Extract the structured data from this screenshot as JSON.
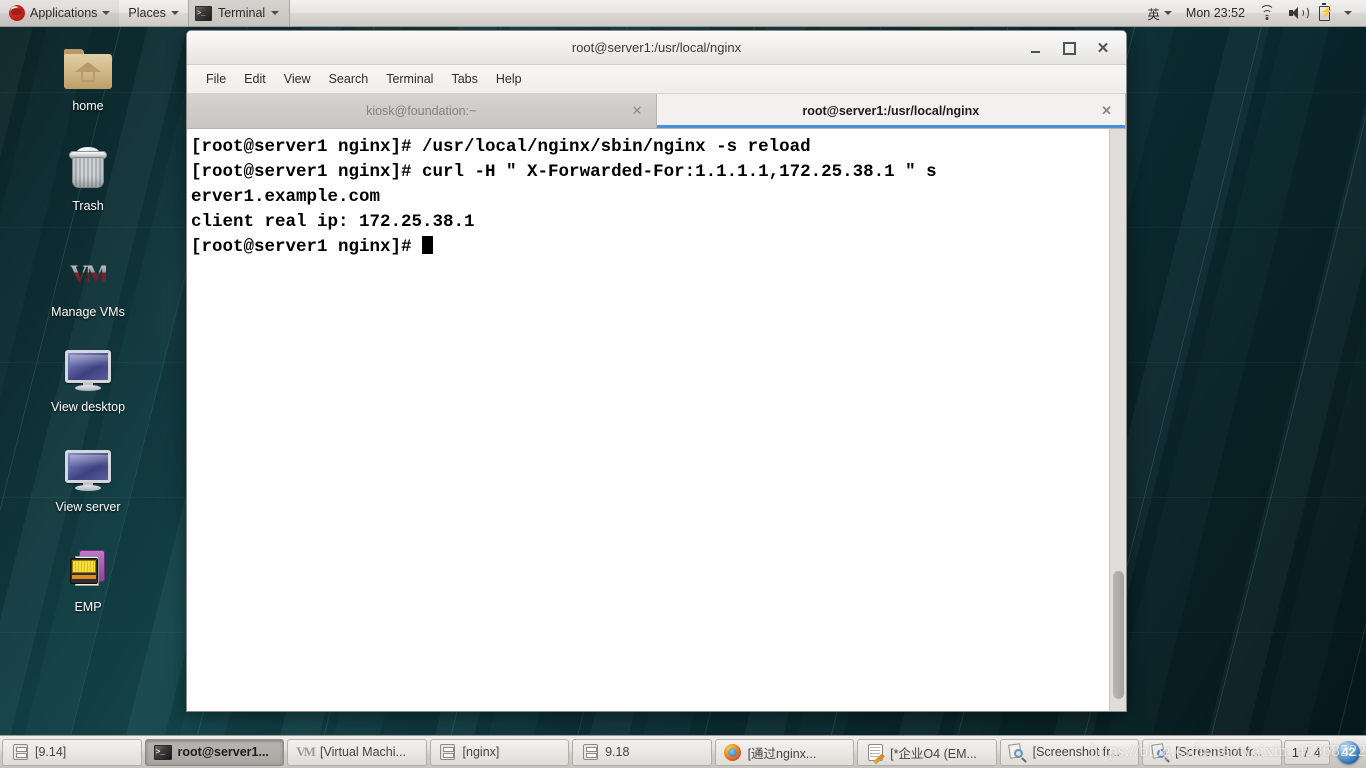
{
  "top_panel": {
    "logo_icon": "redhat-logo-icon",
    "applications_label": "Applications",
    "places_label": "Places",
    "window_task_label": "Terminal",
    "input_method_label": "英",
    "clock": "Mon 23:52",
    "icons": [
      "wifi-icon",
      "volume-icon",
      "battery-icon",
      "chevron-down-icon"
    ]
  },
  "desktop": {
    "icons": [
      {
        "label": "home",
        "icon": "home-folder-icon"
      },
      {
        "label": "Trash",
        "icon": "trash-icon"
      },
      {
        "label": "Manage VMs",
        "icon": "vmware-icon"
      },
      {
        "label": "View desktop",
        "icon": "monitor-icon"
      },
      {
        "label": "View server",
        "icon": "monitor-icon"
      },
      {
        "label": "EMP",
        "icon": "emp-device-icon"
      }
    ]
  },
  "terminal_window": {
    "title": "root@server1:/usr/local/nginx",
    "window_buttons": {
      "minimize": "–",
      "maximize": "□",
      "close": "✕"
    },
    "menu": [
      "File",
      "Edit",
      "View",
      "Search",
      "Terminal",
      "Tabs",
      "Help"
    ],
    "tabs": [
      {
        "label": "kiosk@foundation:~",
        "active": false,
        "close": "✕"
      },
      {
        "label": "root@server1:/usr/local/nginx",
        "active": true,
        "close": "✕"
      }
    ],
    "content_lines": [
      "[root@server1 nginx]# /usr/local/nginx/sbin/nginx -s reload",
      "[root@server1 nginx]# curl -H \" X-Forwarded-For:1.1.1.1,172.25.38.1 \" s",
      "erver1.example.com",
      "client real ip: 172.25.38.1",
      "[root@server1 nginx]# "
    ],
    "prompt": "[root@server1 nginx]# ",
    "scrollbar": "vertical-scrollbar"
  },
  "taskbar": {
    "windows": [
      {
        "label": "[9.14]",
        "icon": "file-drawer-icon",
        "active": false
      },
      {
        "label": "root@server1...",
        "icon": "terminal-icon",
        "active": true
      },
      {
        "label": "[Virtual Machi...",
        "icon": "vmware-icon",
        "active": false
      },
      {
        "label": "[nginx]",
        "icon": "file-drawer-icon",
        "active": false
      },
      {
        "label": "9.18",
        "icon": "file-drawer-icon",
        "active": false
      },
      {
        "label": "[通过nginx...",
        "icon": "firefox-icon",
        "active": false
      },
      {
        "label": "[*企业O4 (EM...",
        "icon": "notepad-icon",
        "active": false
      },
      {
        "label": "[Screenshot fr...",
        "icon": "screenshot-icon",
        "active": false
      },
      {
        "label": "[Screenshot fr...",
        "icon": "screenshot-icon",
        "active": false
      }
    ],
    "workspace_indicator": "1 / 4",
    "workspace_badge": "42"
  },
  "watermark": "https://blog.csdn.net/weixin_45368522",
  "colors": {
    "desktop_bg": "#0c3238",
    "panel_bg": "#e7e5e3",
    "tab_active_underline": "#4a90d9",
    "terminal_bg": "#ffffff",
    "terminal_fg": "#000000"
  }
}
